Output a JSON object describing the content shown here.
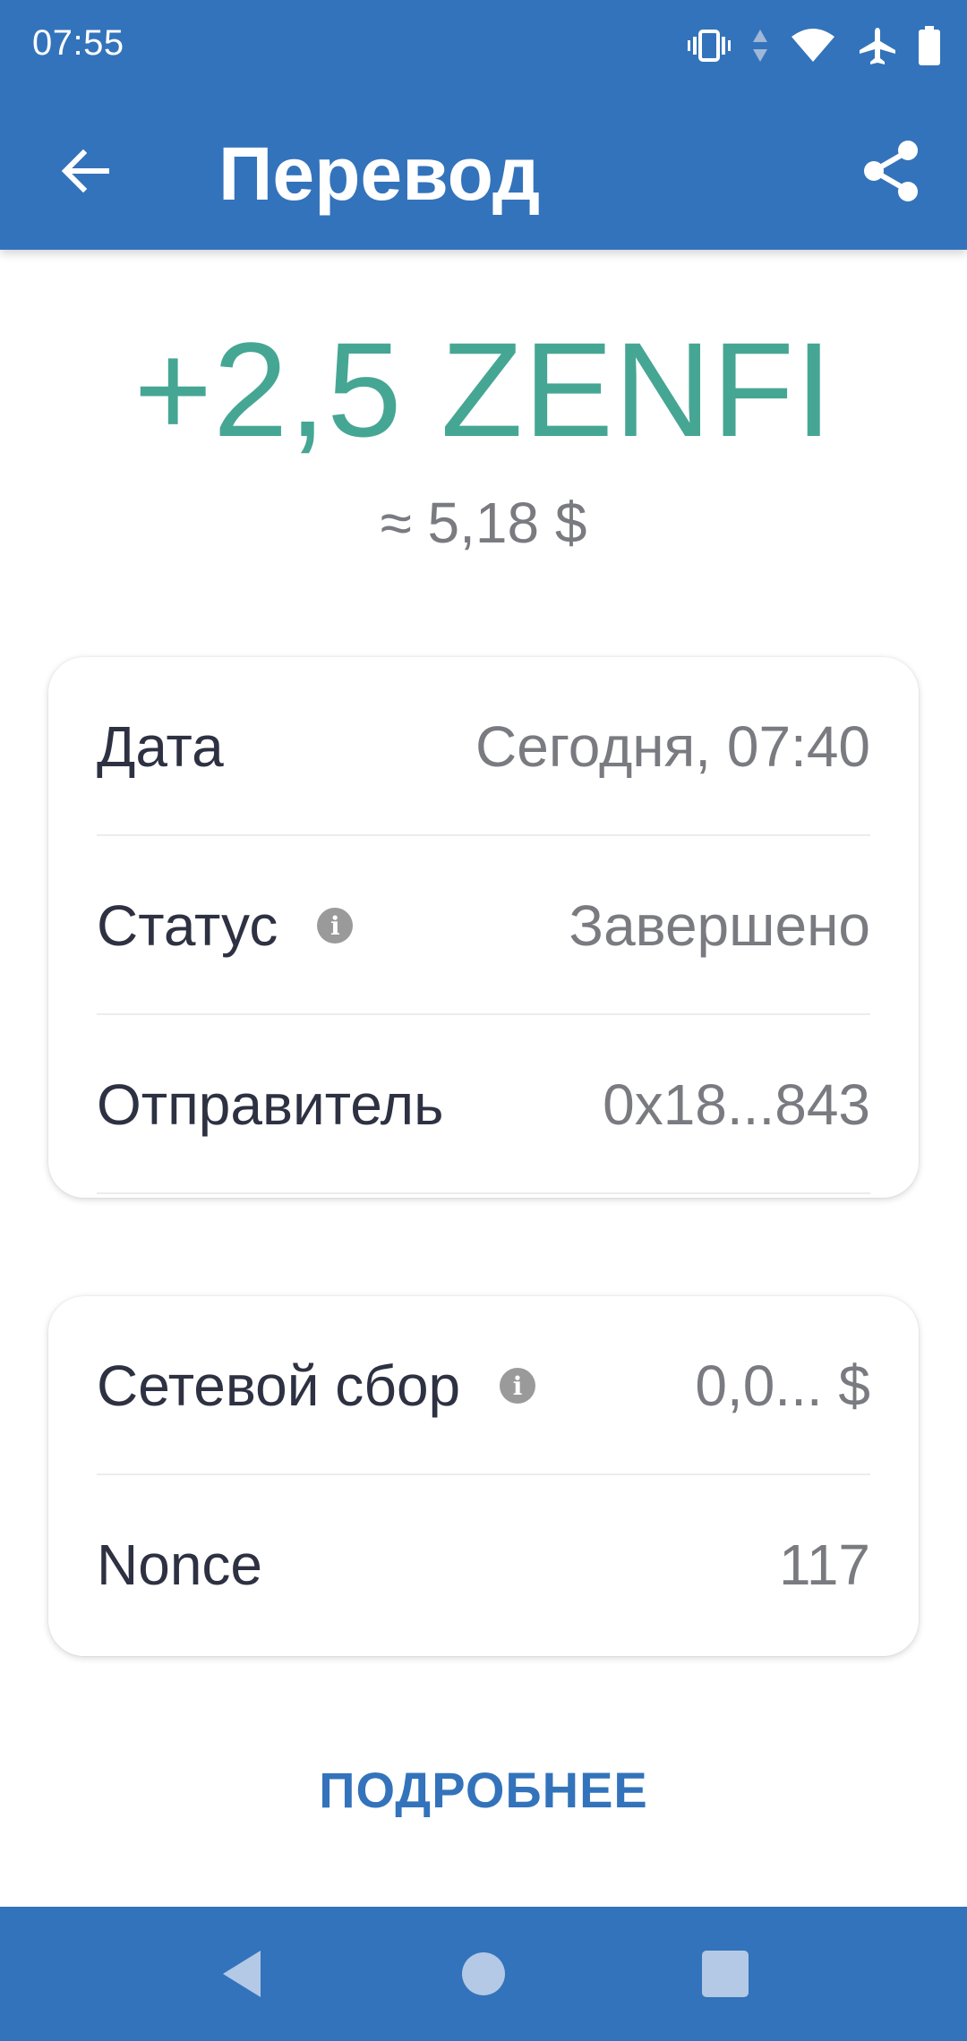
{
  "status_bar": {
    "time": "07:55",
    "icons": [
      "vibrate-icon",
      "data-arrows-icon",
      "wifi-icon",
      "airplane-icon",
      "battery-icon"
    ]
  },
  "toolbar": {
    "title": "Перевод",
    "back_icon": "back-arrow-icon",
    "share_icon": "share-icon"
  },
  "transaction": {
    "amount": "+2,5 ZENFI",
    "fiat_equivalent": "≈ 5,18 $"
  },
  "details_card": {
    "rows": [
      {
        "label": "Дата",
        "value": "Сегодня, 07:40"
      },
      {
        "label": "Статус",
        "value": "Завершено",
        "info": "i"
      },
      {
        "label": "Отправитель",
        "value": "0x18...843"
      }
    ]
  },
  "fee_card": {
    "rows": [
      {
        "label": "Сетевой сбор",
        "value": "0,0... $",
        "info": "i"
      },
      {
        "label": "Nonce",
        "value": "117"
      }
    ]
  },
  "more_button": {
    "label": "ПОДРОБНЕЕ"
  },
  "nav_bar": {
    "icons": [
      "back-triangle-icon",
      "home-circle-icon",
      "recents-square-icon"
    ]
  },
  "colors": {
    "primary": "#3373bb",
    "amount_green": "#46a694",
    "text_dark": "#2d3142",
    "text_gray": "#7a7b80"
  }
}
